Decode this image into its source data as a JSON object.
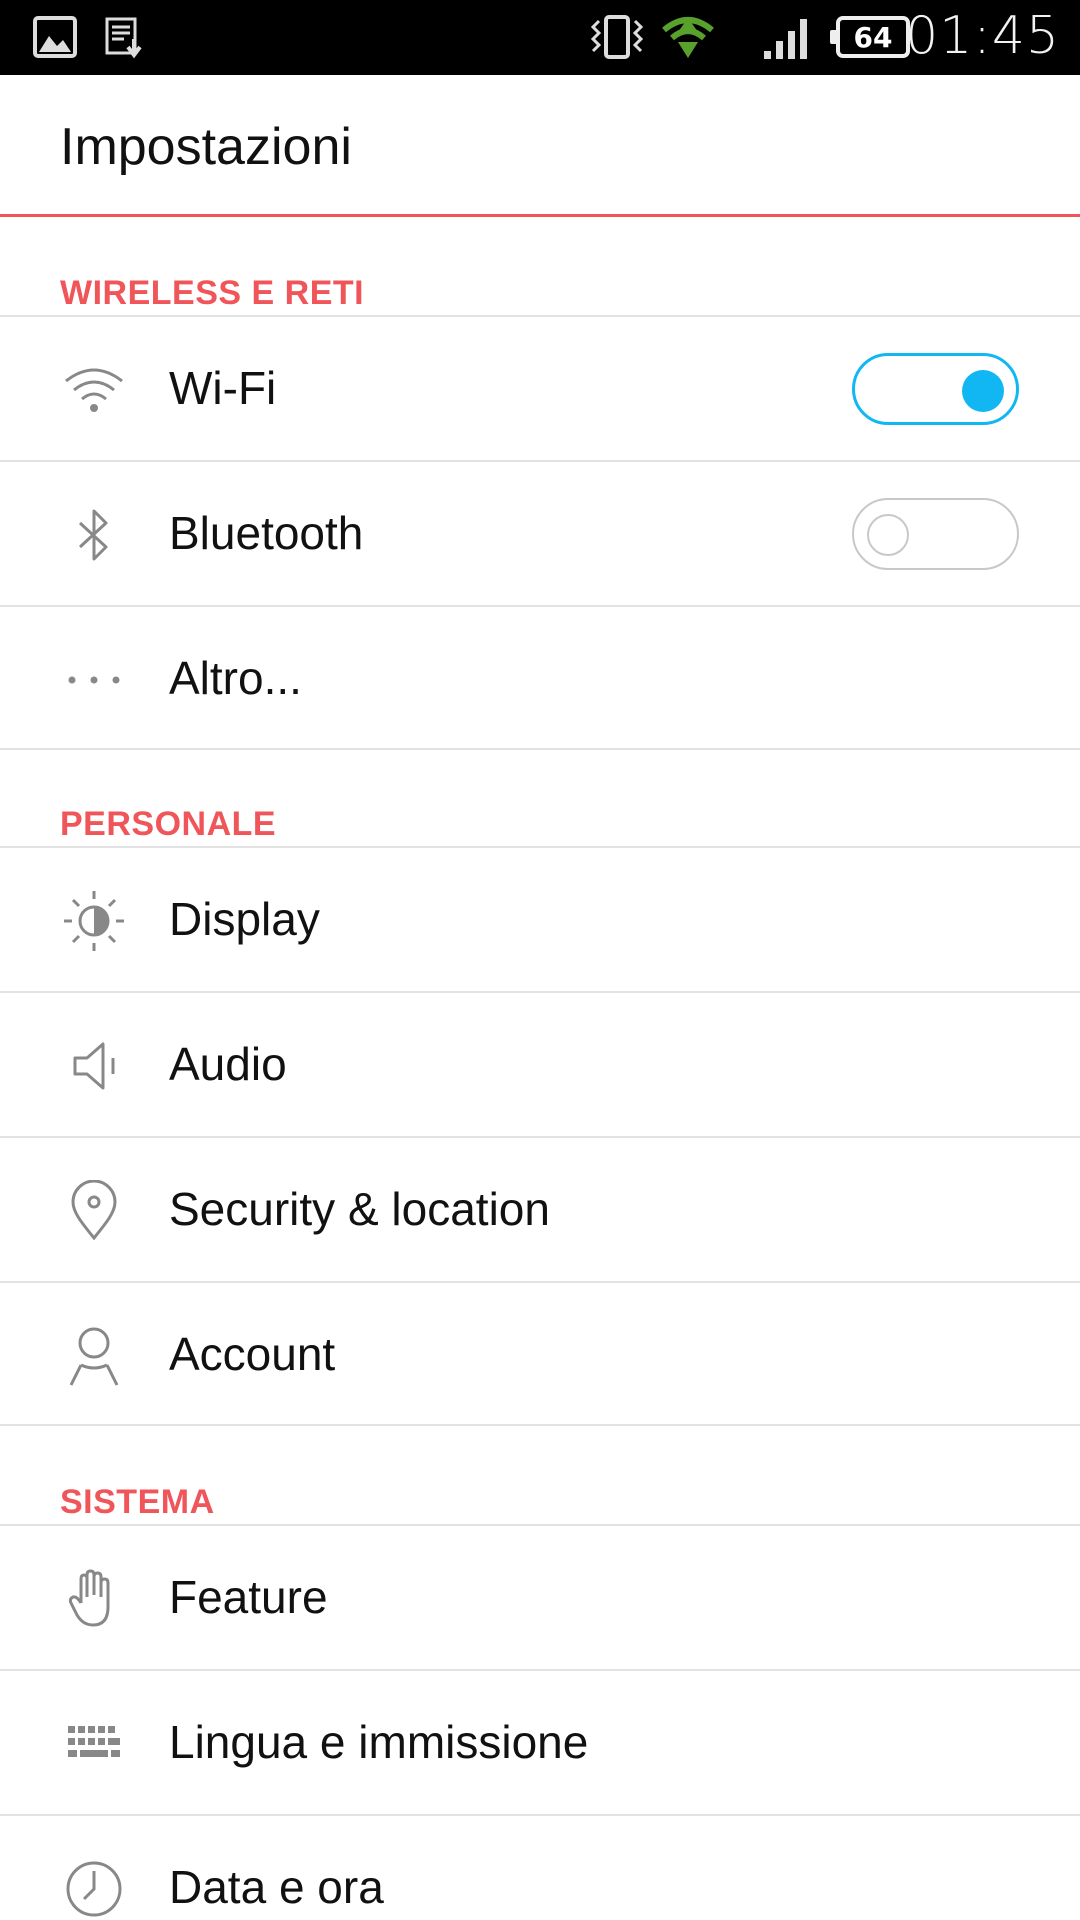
{
  "status_bar": {
    "time": "01:45",
    "battery": "64",
    "icons": [
      "gallery-icon",
      "download-icon",
      "vibrate-icon",
      "wifi-data-icon",
      "signal-icon",
      "battery-icon"
    ]
  },
  "header": {
    "title": "Impostazioni",
    "accent_color": "#f0555a"
  },
  "sections": {
    "wireless": {
      "title": "WIRELESS E RETI",
      "items": [
        {
          "label": "Wi-Fi",
          "icon": "wifi-icon",
          "toggle": "on"
        },
        {
          "label": "Bluetooth",
          "icon": "bluetooth-icon",
          "toggle": "off"
        },
        {
          "label": "Altro...",
          "icon": "more-icon"
        }
      ]
    },
    "personal": {
      "title": "PERSONALE",
      "items": [
        {
          "label": "Display",
          "icon": "brightness-icon"
        },
        {
          "label": "Audio",
          "icon": "speaker-icon"
        },
        {
          "label": "Security & location",
          "icon": "location-pin-icon"
        },
        {
          "label": "Account",
          "icon": "person-icon"
        }
      ]
    },
    "system": {
      "title": "SISTEMA",
      "items": [
        {
          "label": "Feature",
          "icon": "hand-icon"
        },
        {
          "label": "Lingua e immissione",
          "icon": "keyboard-icon"
        },
        {
          "label": "Data e ora",
          "icon": "clock-icon"
        }
      ]
    }
  },
  "colors": {
    "toggle_on": "#11b7f2",
    "toggle_off": "#c8c8c8",
    "section_title": "#f0555a"
  }
}
